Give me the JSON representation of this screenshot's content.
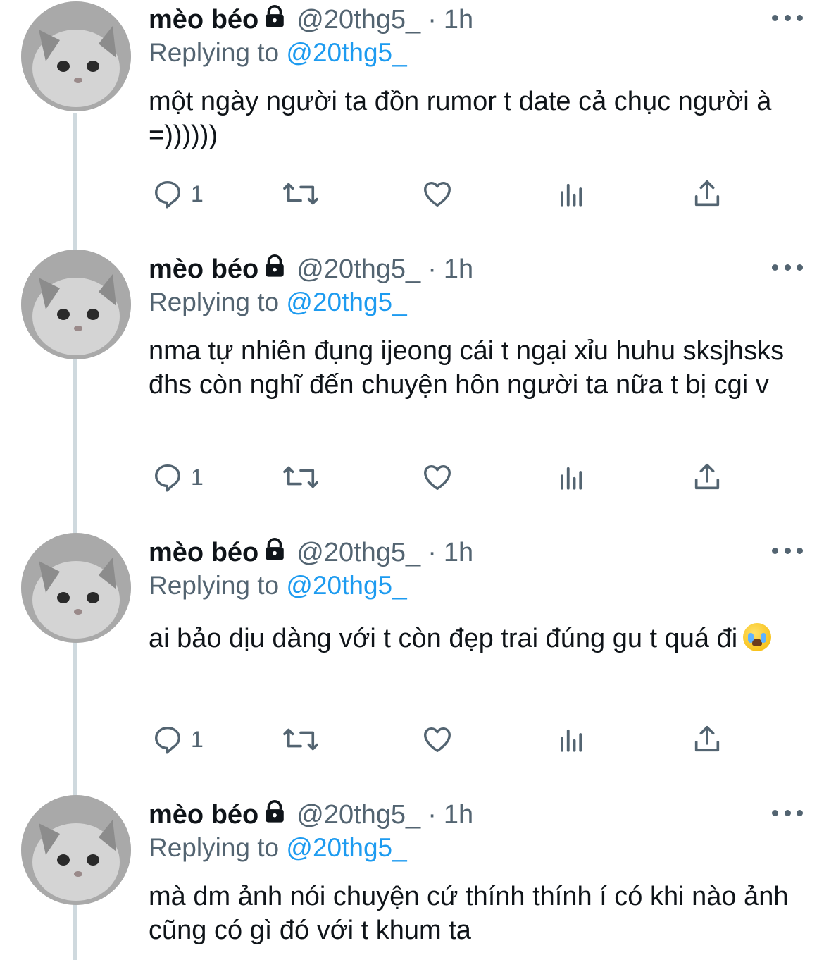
{
  "tweets": [
    {
      "name": "mèo béo",
      "handle": "@20thg5_",
      "separator": "·",
      "time": "1h",
      "replying_label": "Replying to",
      "replying_to": "@20thg5_",
      "text": "một ngày người ta đồn rumor t date cả chục người à =))))))",
      "reply_count": "1"
    },
    {
      "name": "mèo béo",
      "handle": "@20thg5_",
      "separator": "·",
      "time": "1h",
      "replying_label": "Replying to",
      "replying_to": "@20thg5_",
      "text": "nma tự nhiên đụng ijeong cái t ngại xỉu huhu sksjhsks đhs còn nghĩ đến chuyện hôn người ta nữa t bị cgi v",
      "reply_count": "1"
    },
    {
      "name": "mèo béo",
      "handle": "@20thg5_",
      "separator": "·",
      "time": "1h",
      "replying_label": "Replying to",
      "replying_to": "@20thg5_",
      "text": "ai bảo dịu dàng với t còn đẹp trai đúng gu t quá đi",
      "emoji": "loudly-crying-face",
      "reply_count": "1"
    },
    {
      "name": "mèo béo",
      "handle": "@20thg5_",
      "separator": "·",
      "time": "1h",
      "replying_label": "Replying to",
      "replying_to": "@20thg5_",
      "text": "mà dm ảnh nói chuyện cứ thính thính í có khi nào ảnh cũng có gì đó với t khum ta"
    }
  ],
  "icons": {
    "lock": "lock-icon",
    "more": "more-icon",
    "reply": "reply-icon",
    "retweet": "retweet-icon",
    "like": "like-icon",
    "views": "views-icon",
    "share": "share-icon"
  },
  "colors": {
    "mention": "#1d9bf0",
    "secondary": "#536471",
    "thread_line": "#cfd9de"
  }
}
